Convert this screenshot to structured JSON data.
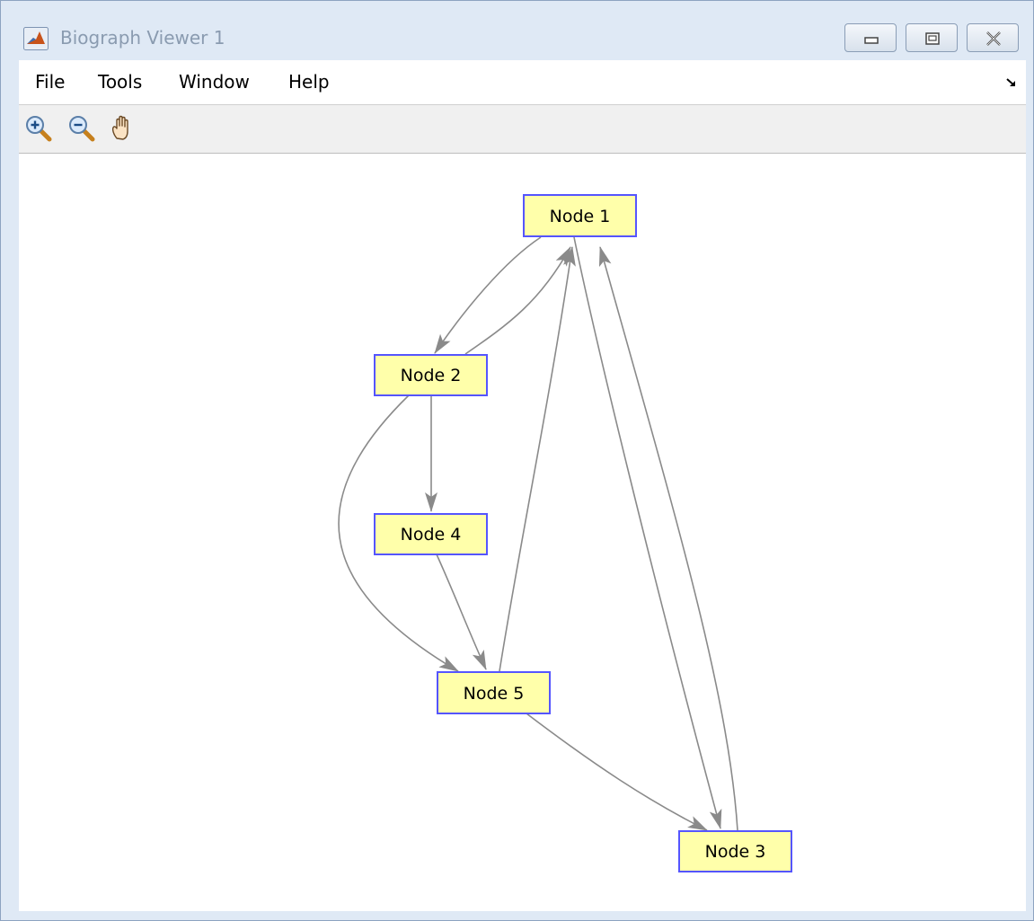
{
  "window": {
    "title": "Biograph Viewer 1",
    "app_icon": "matlab-icon",
    "controls": [
      "minimize-icon",
      "restore-icon",
      "close-icon"
    ]
  },
  "menu": {
    "items": [
      {
        "label": "File"
      },
      {
        "label": "Tools"
      },
      {
        "label": "Window"
      },
      {
        "label": "Help"
      }
    ],
    "dock_icon": "undock-arrow-icon"
  },
  "toolbar": {
    "tools": [
      "zoom-in-icon",
      "zoom-out-icon",
      "pan-hand-icon"
    ]
  },
  "graph": {
    "nodes": [
      {
        "id": "n1",
        "label": "Node 1"
      },
      {
        "id": "n2",
        "label": "Node 2"
      },
      {
        "id": "n4",
        "label": "Node 4"
      },
      {
        "id": "n5",
        "label": "Node 5"
      },
      {
        "id": "n3",
        "label": "Node 3"
      }
    ],
    "edges": [
      {
        "from": "Node 1",
        "to": "Node 2"
      },
      {
        "from": "Node 2",
        "to": "Node 1"
      },
      {
        "from": "Node 2",
        "to": "Node 4"
      },
      {
        "from": "Node 2",
        "to": "Node 5"
      },
      {
        "from": "Node 4",
        "to": "Node 5"
      },
      {
        "from": "Node 5",
        "to": "Node 1"
      },
      {
        "from": "Node 1",
        "to": "Node 3"
      },
      {
        "from": "Node 3",
        "to": "Node 1"
      },
      {
        "from": "Node 5",
        "to": "Node 3"
      }
    ],
    "node_fill": "#ffffaa",
    "node_border": "#5555ff",
    "edge_color": "#8a8a8a"
  }
}
